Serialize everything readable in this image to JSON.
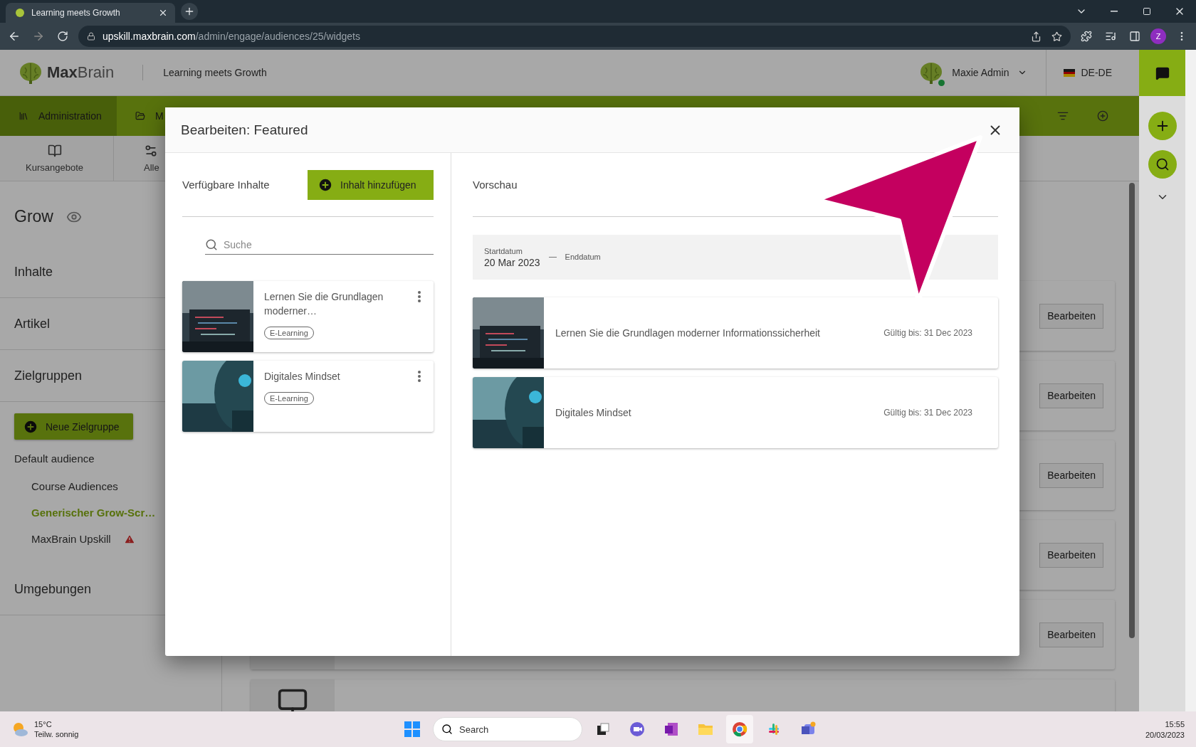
{
  "browser": {
    "tab": {
      "title": "Learning meets Growth"
    },
    "url": {
      "host": "upskill.maxbrain.com",
      "path": "/admin/engage/audiences/25/widgets"
    },
    "profile": "Z"
  },
  "header": {
    "brand": "**Max**Brain",
    "tagline": "Learning meets Growth",
    "user": "Maxie Admin",
    "online": true,
    "locale": "DE-DE"
  },
  "nav": [
    {
      "label": "Administration",
      "selected": true
    },
    {
      "label": "M",
      "selected": false
    }
  ],
  "subnav": [
    {
      "label": "Kursangebote"
    },
    {
      "label": "Alle"
    }
  ],
  "sidebar": {
    "title": "Grow",
    "sections": [
      "Inhalte",
      "Artikel",
      "Zielgruppen"
    ],
    "new_button": "Neue Zielgruppe",
    "group": "Default audience",
    "audiences": [
      {
        "label": "Course Audiences",
        "selected": false,
        "warning": false
      },
      {
        "label": "Generischer Grow-Scr…",
        "selected": true,
        "warning": false
      },
      {
        "label": "MaxBrain Upskill",
        "selected": false,
        "warning": true
      }
    ],
    "footer_section": "Umgebungen"
  },
  "content": {
    "cards": [
      {
        "button": "Bearbeiten"
      },
      {
        "button": "Bearbeiten"
      },
      {
        "button": "Bearbeiten"
      },
      {
        "button": "Bearbeiten"
      },
      {
        "button": "Bearbeiten"
      }
    ]
  },
  "modal": {
    "title": "Bearbeiten: Featured",
    "available": {
      "heading": "Verfügbare Inhalte",
      "add_button": "Inhalt hinzufügen",
      "search": {
        "placeholder": "Suche"
      },
      "items": [
        {
          "title": "Lernen Sie die Grundlagen moderner…",
          "tag": "E-Learning"
        },
        {
          "title": "Digitales Mindset",
          "tag": "E-Learning"
        }
      ]
    },
    "preview": {
      "heading": "Vorschau",
      "start_label": "Startdatum",
      "start_date": "20 Mar 2023",
      "end_label": "Enddatum",
      "items": [
        {
          "title": "Lernen Sie die Grundlagen moderner Informationssicherheit",
          "valid": "Gültig bis: 31 Dec 2023"
        },
        {
          "title": "Digitales Mindset",
          "valid": "Gültig bis: 31 Dec 2023"
        }
      ]
    }
  },
  "taskbar": {
    "temperature": "15°C",
    "weather": "Teilw. sonnig",
    "search": {
      "placeholder": "Search"
    },
    "time": "15:55",
    "date": "20/03/2023"
  }
}
